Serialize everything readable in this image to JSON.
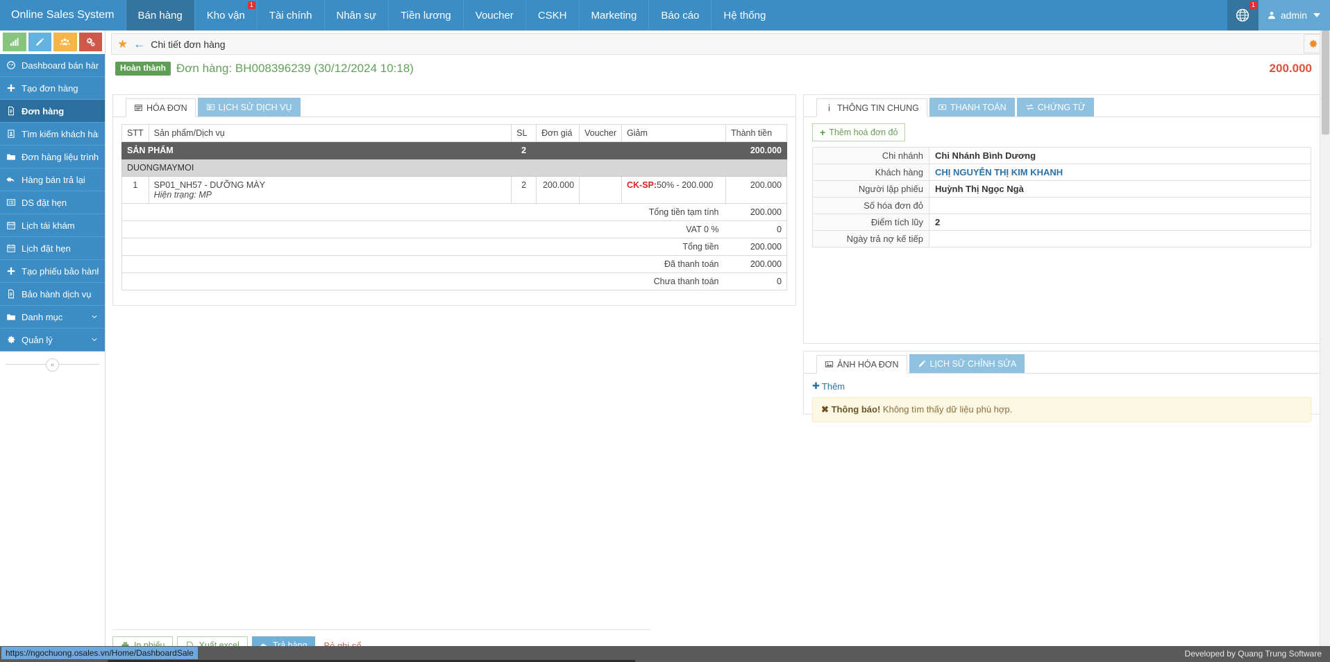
{
  "topnav": {
    "brand": "Online Sales System",
    "items": [
      {
        "label": "Bán hàng",
        "active": true,
        "badge": ""
      },
      {
        "label": "Kho vận",
        "active": false,
        "badge": "1"
      },
      {
        "label": "Tài chính",
        "active": false,
        "badge": ""
      },
      {
        "label": "Nhân sự",
        "active": false,
        "badge": ""
      },
      {
        "label": "Tiền lương",
        "active": false,
        "badge": ""
      },
      {
        "label": "Voucher",
        "active": false,
        "badge": ""
      },
      {
        "label": "CSKH",
        "active": false,
        "badge": ""
      },
      {
        "label": "Marketing",
        "active": false,
        "badge": ""
      },
      {
        "label": "Báo cáo",
        "active": false,
        "badge": ""
      },
      {
        "label": "Hệ thống",
        "active": false,
        "badge": ""
      }
    ],
    "globe_badge": "1",
    "user": "admin"
  },
  "sidebar": {
    "quick_buttons": [
      {
        "icon": "chart-bar-icon",
        "color": "#87c47e"
      },
      {
        "icon": "pencil-icon",
        "color": "#63b3e0"
      },
      {
        "icon": "users-icon",
        "color": "#f5b54a"
      },
      {
        "icon": "cogs-icon",
        "color": "#d0584a"
      }
    ],
    "items": [
      {
        "label": "Dashboard bán hàng",
        "icon": "dashboard-icon",
        "active": false,
        "expandable": false
      },
      {
        "label": "Tạo đơn hàng",
        "icon": "plus-icon",
        "active": false,
        "expandable": false
      },
      {
        "label": "Đơn hàng",
        "icon": "file-icon",
        "active": true,
        "expandable": false
      },
      {
        "label": "Tìm kiếm khách hàng",
        "icon": "contact-card-icon",
        "active": false,
        "expandable": false
      },
      {
        "label": "Đơn hàng liệu trình",
        "icon": "folder-icon",
        "active": false,
        "expandable": false
      },
      {
        "label": "Hàng bán trả lại",
        "icon": "reply-all-icon",
        "active": false,
        "expandable": false
      },
      {
        "label": "DS đặt hẹn",
        "icon": "list-icon",
        "active": false,
        "expandable": false
      },
      {
        "label": "Lịch tái khám",
        "icon": "calendar-icon",
        "active": false,
        "expandable": false
      },
      {
        "label": "Lịch đặt hẹn",
        "icon": "calendar-icon",
        "active": false,
        "expandable": false
      },
      {
        "label": "Tạo phiếu bảo hành",
        "icon": "plus-icon",
        "active": false,
        "expandable": false
      },
      {
        "label": "Bảo hành dịch vụ",
        "icon": "file-icon",
        "active": false,
        "expandable": false
      },
      {
        "label": "Danh mục",
        "icon": "folder-icon",
        "active": false,
        "expandable": true
      },
      {
        "label": "Quản lý",
        "icon": "gear-icon",
        "active": false,
        "expandable": true
      }
    ],
    "collapse_label": "«"
  },
  "page": {
    "title": "Chi tiết đơn hàng",
    "status_badge": "Hoàn thành",
    "order_title": "Đơn hàng: BH008396239 (30/12/2024 10:18)",
    "order_total": "200.000"
  },
  "left_tabs": [
    {
      "label": "HÓA ĐƠN",
      "icon": "invoice-icon",
      "active": true
    },
    {
      "label": "LỊCH SỬ DỊCH VỤ",
      "icon": "history-list-icon",
      "active": false
    }
  ],
  "invoice_table": {
    "headers": [
      "STT",
      "Sản phẩm/Dịch vụ",
      "SL",
      "Đơn giá",
      "Voucher",
      "Giảm",
      "Thành tiền"
    ],
    "group_dark": {
      "label": "SẢN PHẨM",
      "qty": "2",
      "amount": "200.000"
    },
    "group_light": {
      "label": "DUONGMAYMOI"
    },
    "rows": [
      {
        "stt": "1",
        "product": "SP01_NH57 - DƯỠNG MÀY",
        "status_note": "Hiện trạng: MP",
        "qty": "2",
        "price": "200.000",
        "voucher": "",
        "discount_tag": "CK-SP:",
        "discount_rest": "50% - 200.000",
        "amount": "200.000"
      }
    ],
    "summary": [
      {
        "label": "Tổng tiền tạm tính",
        "value": "200.000"
      },
      {
        "label": "VAT 0 %",
        "value": "0"
      },
      {
        "label": "Tổng tiền",
        "value": "200.000"
      },
      {
        "label": "Đã thanh toán",
        "value": "200.000"
      },
      {
        "label": "Chưa thanh toán",
        "value": "0"
      }
    ]
  },
  "right_tabs": [
    {
      "label": "THÔNG TIN CHUNG",
      "icon": "info-icon",
      "active": true
    },
    {
      "label": "THANH TOÁN",
      "icon": "money-icon",
      "active": false
    },
    {
      "label": "CHỨNG TỪ",
      "icon": "exchange-icon",
      "active": false
    }
  ],
  "right_panel": {
    "add_red_invoice": "Thêm hoá đơn đỏ",
    "info_rows": [
      {
        "key": "Chi nhánh",
        "value": "Chi Nhánh Bình Dương",
        "link": false
      },
      {
        "key": "Khách hàng",
        "value": "CHỊ NGUYỄN THỊ KIM KHANH",
        "link": true
      },
      {
        "key": "Người lập phiếu",
        "value": "Huỳnh Thị Ngọc Ngà",
        "link": false
      },
      {
        "key": "Số hóa đơn đỏ",
        "value": "",
        "link": false
      },
      {
        "key": "Điểm tích lũy",
        "value": "2",
        "link": false
      },
      {
        "key": "Ngày trả nợ kế tiếp",
        "value": "",
        "link": false
      }
    ]
  },
  "image_tabs": [
    {
      "label": "ẢNH HÓA ĐƠN",
      "icon": "image-icon",
      "active": true
    },
    {
      "label": "LỊCH SỬ CHỈNH SỬA",
      "icon": "edit-history-icon",
      "active": false
    }
  ],
  "image_panel": {
    "add_label": "Thêm",
    "alert_title": "Thông báo!",
    "alert_text": "Không tìm thấy dữ liệu phù hợp."
  },
  "footer_buttons": {
    "print": "In phiếu",
    "export": "Xuất excel",
    "return": "Trả hàng",
    "unpost": "Bỏ ghi sổ"
  },
  "statusbar": {
    "url": "https://ngochuong.osales.vn/Home/DashboardSale",
    "credit": "Developed by Quang Trung Software"
  },
  "colors": {
    "nav_blue": "#3c8dc5",
    "nav_active": "#34749f",
    "sidebar_blue": "#3c8dc5",
    "sidebar_active": "#2b6f9e",
    "green_badge": "#5e9e55",
    "total_red": "#e0513b",
    "tab_blue": "#8ec2e0",
    "warn_bg": "#fcf8e3"
  }
}
